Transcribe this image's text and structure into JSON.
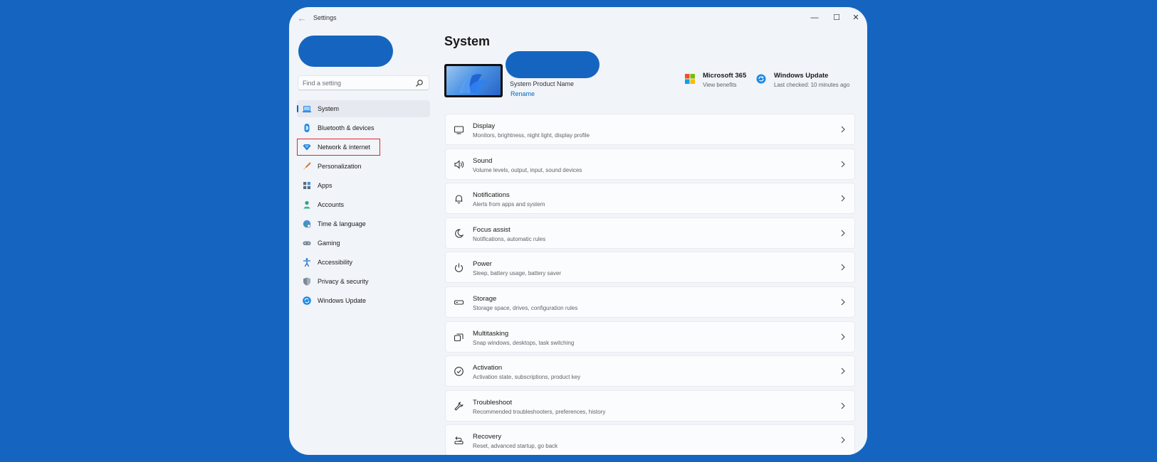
{
  "window": {
    "title": "Settings",
    "back_glyph": "←",
    "minimize_glyph": "—",
    "maximize_glyph": "☐",
    "close_glyph": "✕"
  },
  "search": {
    "placeholder": "Find a setting",
    "value": ""
  },
  "sidebar": {
    "items": [
      {
        "label": "System",
        "icon": "laptop-icon",
        "selected": true
      },
      {
        "label": "Bluetooth & devices",
        "icon": "bluetooth-icon"
      },
      {
        "label": "Network & internet",
        "icon": "wifi-diamond-icon",
        "highlighted": true
      },
      {
        "label": "Personalization",
        "icon": "brush-icon"
      },
      {
        "label": "Apps",
        "icon": "apps-icon"
      },
      {
        "label": "Accounts",
        "icon": "person-icon"
      },
      {
        "label": "Time & language",
        "icon": "globe-clock-icon"
      },
      {
        "label": "Gaming",
        "icon": "controller-icon"
      },
      {
        "label": "Accessibility",
        "icon": "accessibility-icon"
      },
      {
        "label": "Privacy & security",
        "icon": "shield-icon"
      },
      {
        "label": "Windows Update",
        "icon": "update-icon"
      }
    ]
  },
  "main": {
    "title": "System",
    "device": {
      "product_name": "System Product Name",
      "rename_label": "Rename"
    },
    "tiles": [
      {
        "title": "Microsoft 365",
        "subtitle": "View benefits",
        "icon": "microsoft-logo-icon"
      },
      {
        "title": "Windows Update",
        "subtitle": "Last checked: 10 minutes ago",
        "icon": "sync-icon"
      }
    ],
    "cards": [
      {
        "title": "Display",
        "subtitle": "Monitors, brightness, night light, display profile",
        "icon": "display-icon"
      },
      {
        "title": "Sound",
        "subtitle": "Volume levels, output, input, sound devices",
        "icon": "speaker-icon"
      },
      {
        "title": "Notifications",
        "subtitle": "Alerts from apps and system",
        "icon": "bell-icon"
      },
      {
        "title": "Focus assist",
        "subtitle": "Notifications, automatic rules",
        "icon": "moon-icon"
      },
      {
        "title": "Power",
        "subtitle": "Sleep, battery usage, battery saver",
        "icon": "power-icon"
      },
      {
        "title": "Storage",
        "subtitle": "Storage space, drives, configuration rules",
        "icon": "storage-icon"
      },
      {
        "title": "Multitasking",
        "subtitle": "Snap windows, desktops, task switching",
        "icon": "multitask-icon"
      },
      {
        "title": "Activation",
        "subtitle": "Activation state, subscriptions, product key",
        "icon": "check-circle-icon"
      },
      {
        "title": "Troubleshoot",
        "subtitle": "Recommended troubleshooters, preferences, history",
        "icon": "wrench-icon"
      },
      {
        "title": "Recovery",
        "subtitle": "Reset, advanced startup, go back",
        "icon": "recovery-icon"
      }
    ]
  },
  "colors": {
    "background": "#1565c0",
    "accent": "#0067c0",
    "highlight_box": "#e0262b",
    "window_bg": "#f1f4f9",
    "card_bg": "#fbfcfd"
  }
}
